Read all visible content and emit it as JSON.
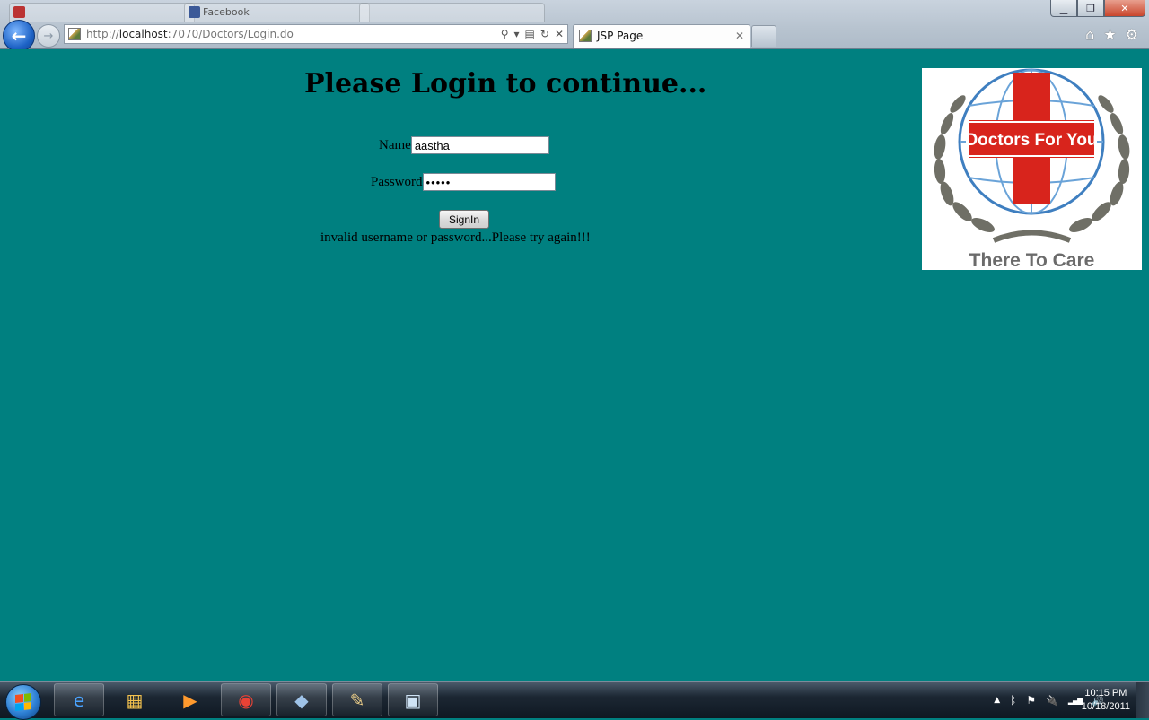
{
  "browser": {
    "background_tabs": [
      "",
      "Facebook",
      ""
    ],
    "window_buttons": {
      "minimize": "▁",
      "maximize": "❐",
      "close": "✕"
    },
    "address_prefix": "http://",
    "address_host": "localhost",
    "address_rest": ":7070/Doctors/Login.do",
    "address_icons": {
      "search": "⚲",
      "dropdown": "▾",
      "compat": "▤",
      "refresh": "↻",
      "stop": "✕"
    },
    "active_tab_title": "JSP Page",
    "tab_close": "✕",
    "tools": {
      "home": "⌂",
      "favorites": "★",
      "settings": "⚙"
    }
  },
  "page": {
    "heading": "Please Login to continue...",
    "name_label": "Name",
    "name_value": "aastha",
    "password_label": "Password",
    "password_value": "•••••",
    "signin_label": "SignIn",
    "error_message": "invalid username or password...Please try again!!!",
    "logo": {
      "banner_text": "Doctors For You",
      "tagline": "There To Care"
    }
  },
  "taskbar": {
    "items": [
      {
        "name": "internet-explorer-icon",
        "glyph": "e",
        "color": "#4aa3ff"
      },
      {
        "name": "file-explorer-icon",
        "glyph": "▦",
        "color": "#f2c14e"
      },
      {
        "name": "media-player-icon",
        "glyph": "▶",
        "color": "#ff9a2e"
      },
      {
        "name": "chrome-icon",
        "glyph": "◉",
        "color": "#e94235"
      },
      {
        "name": "virtualbox-icon",
        "glyph": "◆",
        "color": "#9fc3e8"
      },
      {
        "name": "paint-icon",
        "glyph": "✎",
        "color": "#f1d28a"
      },
      {
        "name": "presentation-icon",
        "glyph": "▣",
        "color": "#cfe3f5"
      }
    ],
    "tray": {
      "show_hidden": "▲",
      "bluetooth": "ᛒ",
      "action_center": "⚑",
      "power": "🔌",
      "network": "▂▄▆",
      "volume": "🔊"
    },
    "time": "10:15 PM",
    "date": "10/18/2011"
  }
}
